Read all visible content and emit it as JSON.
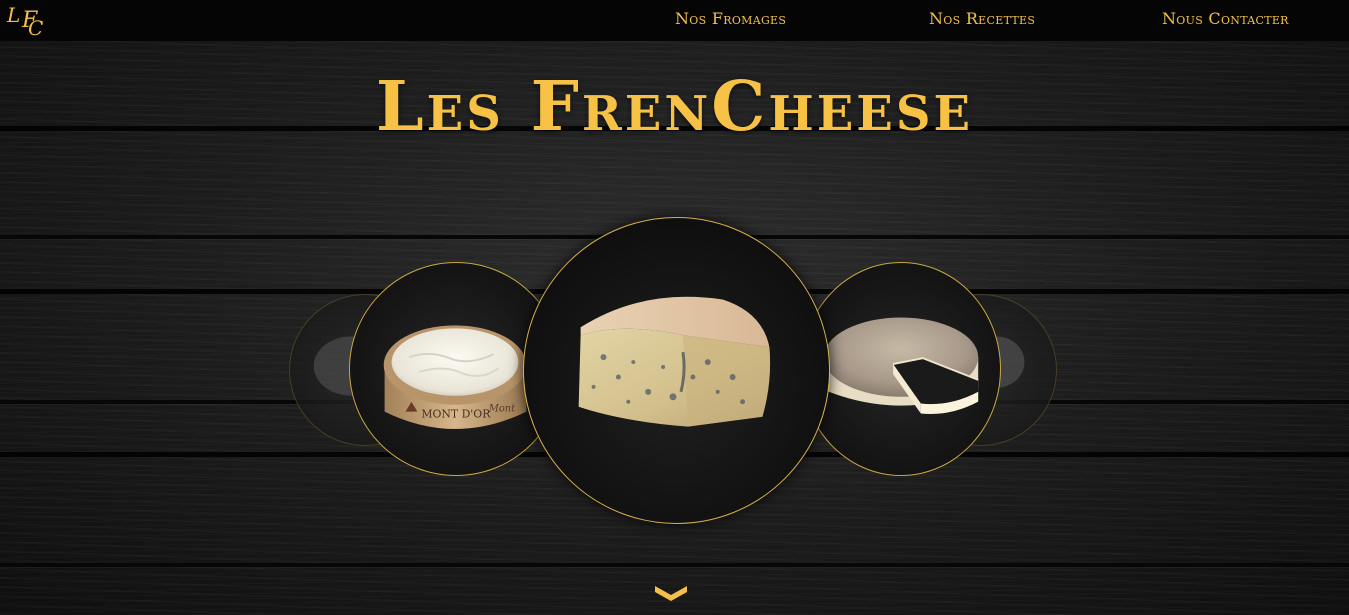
{
  "header": {
    "logo_text": "LFC",
    "nav": [
      {
        "label": "Nos Fromages"
      },
      {
        "label": "Nos Recettes"
      },
      {
        "label": "Nous Contacter"
      }
    ]
  },
  "hero": {
    "title": "Les FrenCheese"
  },
  "carousel": {
    "slides": [
      {
        "name": "slide-far-left"
      },
      {
        "name": "mont-d-or",
        "label": "MONT D'OR"
      },
      {
        "name": "blue-cheese"
      },
      {
        "name": "soft-rind-cheese"
      },
      {
        "name": "slide-far-right"
      }
    ],
    "active_index": 2
  },
  "colors": {
    "accent": "#f4c04a",
    "navbar_bg": "#050505",
    "background": "#1b1b1b"
  },
  "icons": {
    "scroll_down": "chevron-down-icon"
  }
}
